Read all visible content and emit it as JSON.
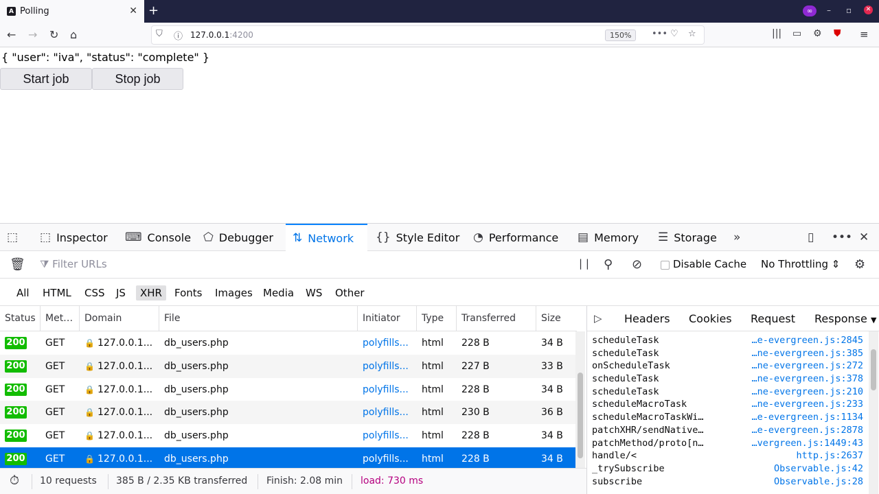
{
  "browser": {
    "tab_title": "Polling",
    "favicon": "A",
    "new_tab": "+",
    "url_host": "127.0.0.1",
    "url_port": ":4200",
    "zoom": "150%"
  },
  "page": {
    "json_text": "{ \"user\": \"iva\", \"status\": \"complete\" }",
    "start_label": "Start job",
    "stop_label": "Stop job"
  },
  "devtools": {
    "tabs": [
      "Inspector",
      "Console",
      "Debugger",
      "Network",
      "Style Editor",
      "Performance",
      "Memory",
      "Storage"
    ],
    "active_tab": "Network",
    "filter_placeholder": "Filter URLs",
    "disable_cache": "Disable Cache",
    "throttling": "No Throttling",
    "type_filters": [
      "All",
      "HTML",
      "CSS",
      "JS",
      "XHR",
      "Fonts",
      "Images",
      "Media",
      "WS",
      "Other"
    ],
    "active_type": "XHR",
    "columns": [
      "Status",
      "Met…",
      "Domain",
      "File",
      "Initiator",
      "Type",
      "Transferred",
      "Size"
    ],
    "rows": [
      {
        "status": "200",
        "method": "GET",
        "domain": "127.0.0.1...",
        "file": "db_users.php",
        "initiator": "polyfills...",
        "type": "html",
        "transferred": "228 B",
        "size": "34 B"
      },
      {
        "status": "200",
        "method": "GET",
        "domain": "127.0.0.1...",
        "file": "db_users.php",
        "initiator": "polyfills...",
        "type": "html",
        "transferred": "227 B",
        "size": "33 B"
      },
      {
        "status": "200",
        "method": "GET",
        "domain": "127.0.0.1...",
        "file": "db_users.php",
        "initiator": "polyfills...",
        "type": "html",
        "transferred": "228 B",
        "size": "34 B"
      },
      {
        "status": "200",
        "method": "GET",
        "domain": "127.0.0.1...",
        "file": "db_users.php",
        "initiator": "polyfills...",
        "type": "html",
        "transferred": "230 B",
        "size": "36 B"
      },
      {
        "status": "200",
        "method": "GET",
        "domain": "127.0.0.1...",
        "file": "db_users.php",
        "initiator": "polyfills...",
        "type": "html",
        "transferred": "228 B",
        "size": "34 B"
      },
      {
        "status": "200",
        "method": "GET",
        "domain": "127.0.0.1...",
        "file": "db_users.php",
        "initiator": "polyfills...",
        "type": "html",
        "transferred": "228 B",
        "size": "34 B"
      }
    ],
    "summary": {
      "requests": "10 requests",
      "transferred": "385 B / 2.35 KB transferred",
      "finish": "Finish: 2.08 min",
      "load": "load: 730 ms"
    },
    "side_tabs": [
      "Headers",
      "Cookies",
      "Request",
      "Response"
    ],
    "stack": [
      {
        "fn": "scheduleTask",
        "src": "…e-evergreen.js:2845"
      },
      {
        "fn": "scheduleTask",
        "src": "…ne-evergreen.js:385"
      },
      {
        "fn": "onScheduleTask",
        "src": "…ne-evergreen.js:272"
      },
      {
        "fn": "scheduleTask",
        "src": "…ne-evergreen.js:378"
      },
      {
        "fn": "scheduleTask",
        "src": "…ne-evergreen.js:210"
      },
      {
        "fn": "scheduleMacroTask",
        "src": "…ne-evergreen.js:233"
      },
      {
        "fn": "scheduleMacroTaskWi…",
        "src": "…e-evergreen.js:1134"
      },
      {
        "fn": "patchXHR/sendNative…",
        "src": "…e-evergreen.js:2878"
      },
      {
        "fn": "patchMethod/proto[n…",
        "src": "…vergreen.js:1449:43"
      },
      {
        "fn": "handle/<",
        "src": "http.js:2637"
      },
      {
        "fn": "_trySubscribe",
        "src": "Observable.js:42"
      },
      {
        "fn": "subscribe",
        "src": "Observable.js:28"
      }
    ],
    "colors": {
      "accent": "#0074e8",
      "status_ok": "#12bc00",
      "load": "#b5007f"
    }
  }
}
